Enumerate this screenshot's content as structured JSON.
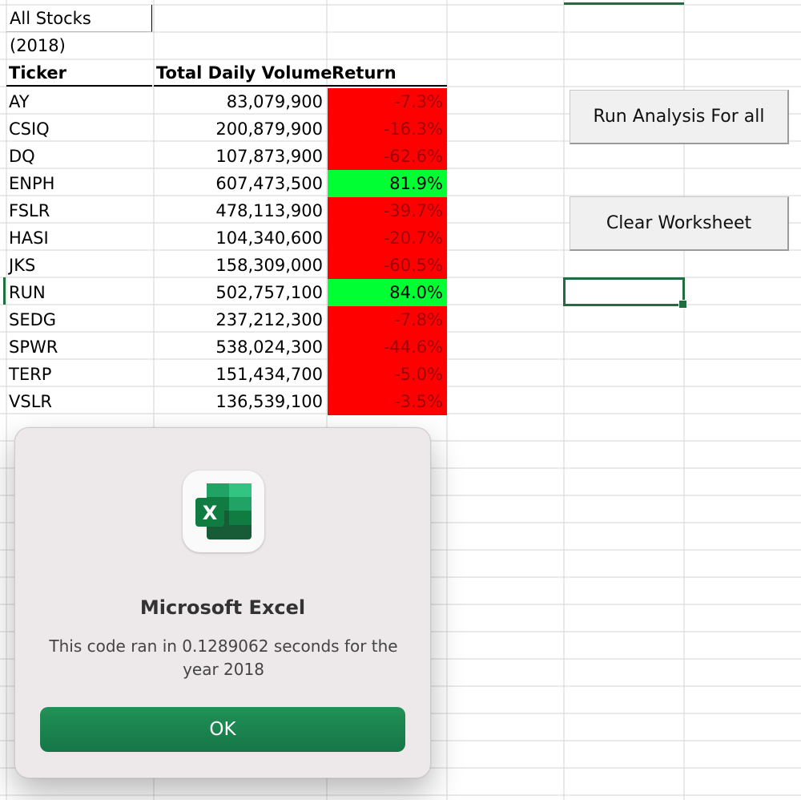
{
  "sheet": {
    "title": "All Stocks (2018)",
    "headers": {
      "ticker": "Ticker",
      "volume": "Total Daily Volume",
      "return": "Return"
    },
    "rows": [
      {
        "ticker": "AY",
        "volume": "83,079,900",
        "return": "-7.3%",
        "positive": false
      },
      {
        "ticker": "CSIQ",
        "volume": "200,879,900",
        "return": "-16.3%",
        "positive": false
      },
      {
        "ticker": "DQ",
        "volume": "107,873,900",
        "return": "-62.6%",
        "positive": false
      },
      {
        "ticker": "ENPH",
        "volume": "607,473,500",
        "return": "81.9%",
        "positive": true
      },
      {
        "ticker": "FSLR",
        "volume": "478,113,900",
        "return": "-39.7%",
        "positive": false
      },
      {
        "ticker": "HASI",
        "volume": "104,340,600",
        "return": "-20.7%",
        "positive": false
      },
      {
        "ticker": "JKS",
        "volume": "158,309,000",
        "return": "-60.5%",
        "positive": false
      },
      {
        "ticker": "RUN",
        "volume": "502,757,100",
        "return": "84.0%",
        "positive": true
      },
      {
        "ticker": "SEDG",
        "volume": "237,212,300",
        "return": "-7.8%",
        "positive": false
      },
      {
        "ticker": "SPWR",
        "volume": "538,024,300",
        "return": "-44.6%",
        "positive": false
      },
      {
        "ticker": "TERP",
        "volume": "151,434,700",
        "return": "-5.0%",
        "positive": false
      },
      {
        "ticker": "VSLR",
        "volume": "136,539,100",
        "return": "-3.5%",
        "positive": false
      }
    ]
  },
  "buttons": {
    "run_analysis": "Run Analysis For all",
    "clear_worksheet": "Clear Worksheet"
  },
  "dialog": {
    "app_name": "Microsoft Excel",
    "icon": "excel-app-icon",
    "message": "This code ran in 0.1289062 seconds for the year 2018",
    "ok_label": "OK"
  },
  "colors": {
    "negative_fill": "#ff0000",
    "negative_text": "#9c0006",
    "positive_fill": "#00ff33",
    "excel_green": "#1e6e42",
    "ok_button": "#1a8450"
  }
}
